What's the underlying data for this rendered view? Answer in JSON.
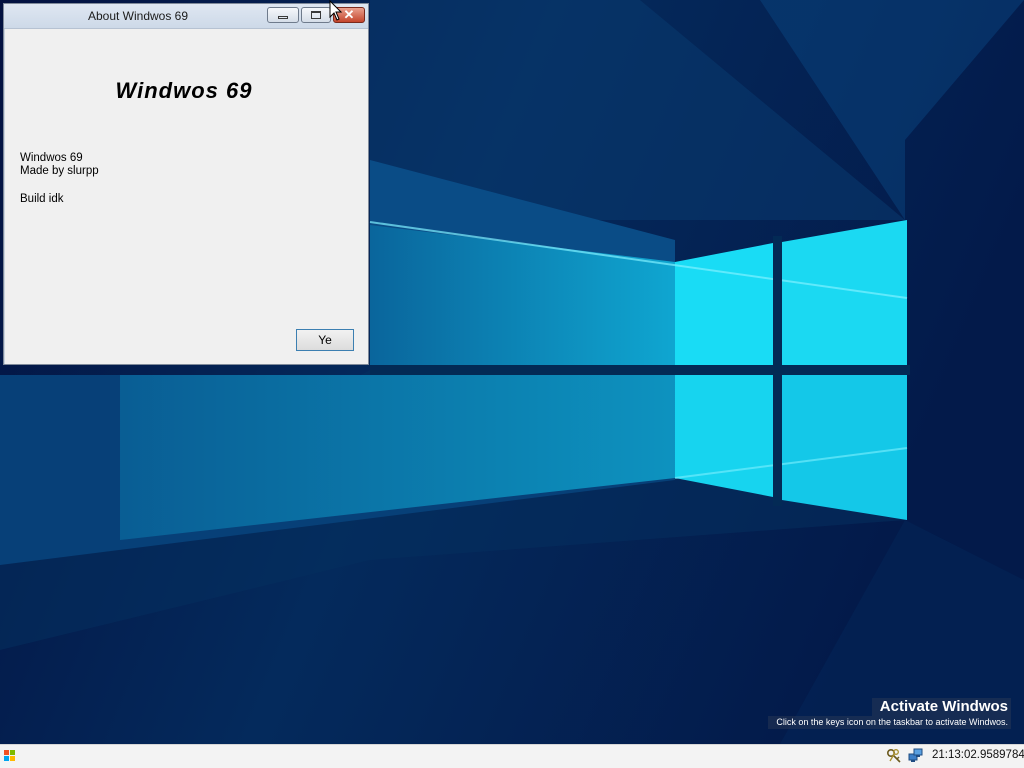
{
  "window": {
    "title": "About Windwos 69",
    "heading": "Windwos 69",
    "info_lines": [
      "Windwos 69",
      "Made by slurpp",
      "Build idk"
    ],
    "ok_label": "Ye",
    "controls": [
      "minimize-icon",
      "maximize-icon",
      "close-icon"
    ]
  },
  "watermark": {
    "title": "Activate Windwos",
    "subtitle": "Click on the keys icon on the taskbar to activate Windwos."
  },
  "taskbar": {
    "start_icon": "windows-logo-icon",
    "tray_icons": [
      "keys-icon",
      "network-icon"
    ],
    "clock": "21:13:02.9589784"
  },
  "colors": {
    "desktop_background": "#03103a",
    "wallpaper_glow": "#19dcf5",
    "window_background": "#f0f0f0",
    "close_button": "#c4452c",
    "taskbar": "#f3f3f3"
  }
}
